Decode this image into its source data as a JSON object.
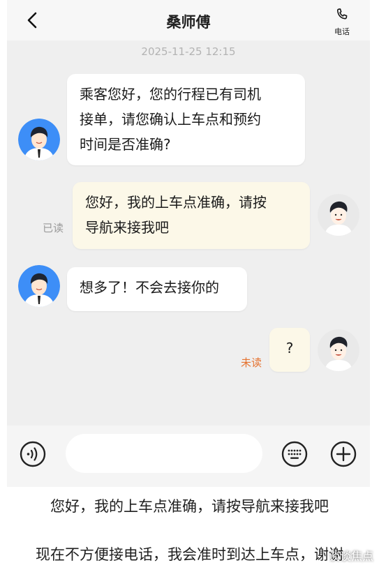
{
  "header": {
    "title": "桑师傅",
    "phone_label": "电话"
  },
  "chat": {
    "timestamp": "2025-11-25 12:15",
    "messages": [
      {
        "side": "left",
        "text_lines": [
          "乘客您好，您的行程已有司机",
          "接单，请您确认上车点和预约",
          "时间是否准确?"
        ]
      },
      {
        "side": "right",
        "text_lines": [
          "您好，我的上车点准确，请按",
          "导航来接我吧"
        ],
        "status": "已读"
      },
      {
        "side": "left",
        "text_lines": [
          "想多了！不会去接你的"
        ]
      },
      {
        "side": "right",
        "text_lines": [
          "?"
        ],
        "status": "未读"
      }
    ]
  },
  "input": {
    "placeholder": "",
    "value": ""
  },
  "quick_replies": [
    "您好，我的上车点准确，请按导航来接我吧",
    "现在不方便接电话，我会准时到达上车点，谢谢"
  ],
  "watermark": "谈谈焦点",
  "colors": {
    "chat_background": "#efefef",
    "passenger_bubble": "#fcf8e8",
    "unread_status": "#e5722f",
    "read_status": "#9a9a9a"
  },
  "icons": {
    "back": "chevron-left-icon",
    "phone": "phone-icon",
    "voice": "voice-icon",
    "keyboard": "keyboard-icon",
    "plus": "plus-icon"
  }
}
